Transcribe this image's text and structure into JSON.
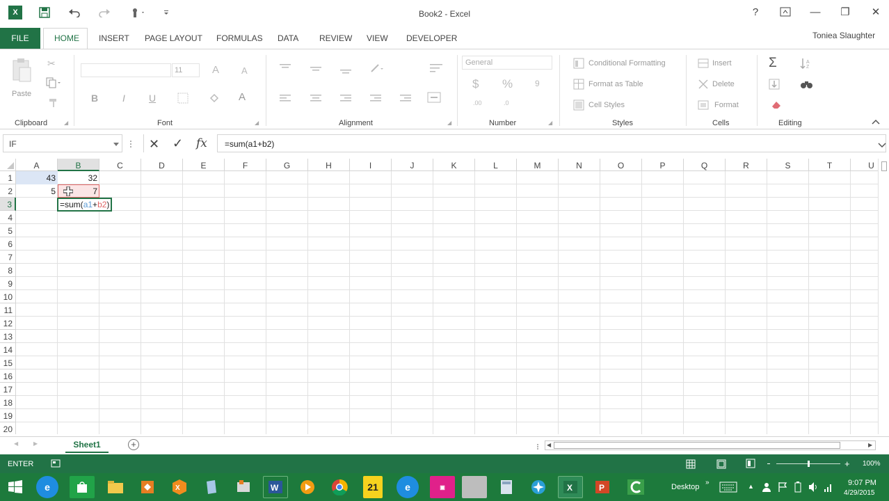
{
  "window": {
    "title": "Book2 - Excel",
    "help": "?",
    "minimize": "—",
    "restore": "❐",
    "close": "✕"
  },
  "qat": {
    "app_icon": "X",
    "save_icon": "save-icon",
    "undo_icon": "undo-icon",
    "redo_icon": "redo-icon",
    "touch_icon": "touch-icon"
  },
  "user": "Toniea Slaughter",
  "tabs": [
    "FILE",
    "HOME",
    "INSERT",
    "PAGE LAYOUT",
    "FORMULAS",
    "DATA",
    "REVIEW",
    "VIEW",
    "DEVELOPER"
  ],
  "ribbon": {
    "clipboard": {
      "label": "Clipboard",
      "paste": "Paste"
    },
    "font": {
      "label": "Font",
      "size": "11",
      "bold": "B",
      "italic": "I",
      "underline": "U",
      "grow": "A",
      "shrink": "A",
      "color": "A"
    },
    "alignment": {
      "label": "Alignment"
    },
    "number": {
      "label": "Number",
      "format": "General",
      "currency": "$",
      "percent": "%",
      "comma": "9",
      "inc_decimal": ".00",
      "dec_decimal": ".0"
    },
    "styles": {
      "label": "Styles",
      "conditional": "Conditional Formatting",
      "format_table": "Format as Table",
      "cell_styles": "Cell Styles"
    },
    "cells": {
      "label": "Cells",
      "insert": "Insert",
      "delete": "Delete",
      "format": "Format"
    },
    "editing": {
      "label": "Editing",
      "sum": "Σ"
    }
  },
  "formula_bar": {
    "name_box": "IF",
    "cancel": "✕",
    "enter": "✓",
    "fx": "fx",
    "formula": "=sum(a1+b2)"
  },
  "columns": [
    "A",
    "B",
    "C",
    "D",
    "E",
    "F",
    "G",
    "H",
    "I",
    "J",
    "K",
    "L",
    "M",
    "N",
    "O",
    "P",
    "Q",
    "R",
    "S",
    "T",
    "U"
  ],
  "rows": [
    "1",
    "2",
    "3",
    "4",
    "5",
    "6",
    "7",
    "8",
    "9",
    "10",
    "11",
    "12",
    "13",
    "14",
    "15",
    "16",
    "17",
    "18",
    "19",
    "20"
  ],
  "cells": {
    "A1": "43",
    "B1": "32",
    "A2": "5",
    "B2": "7",
    "B3_prefix": "=sum(",
    "B3_ref1": "a1",
    "B3_plus": "+",
    "B3_ref2": "b2",
    "B3_suffix": ")"
  },
  "sheets": [
    "Sheet1"
  ],
  "status": {
    "mode": "ENTER",
    "zoom": "100%"
  },
  "taskbar": {
    "desktop": "Desktop",
    "time": "9:07 PM",
    "date": "4/29/2015"
  },
  "colors": {
    "accent": "#217346",
    "ref1": "#5b9bd5",
    "ref2": "#e06666"
  }
}
